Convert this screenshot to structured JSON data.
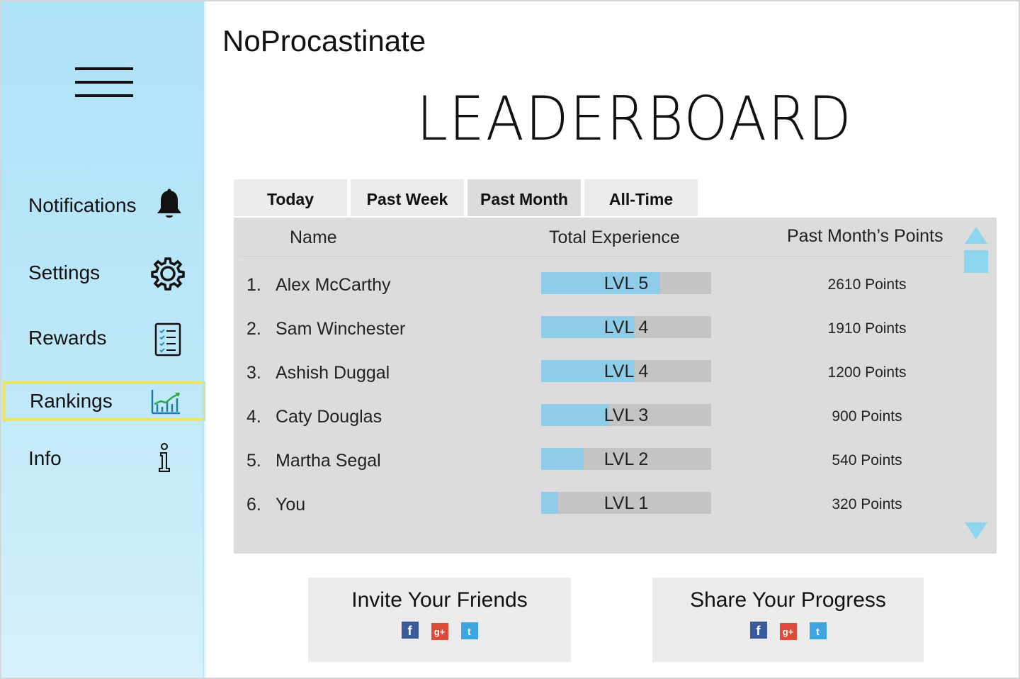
{
  "app": {
    "title": "NoProcastinate"
  },
  "page": {
    "heading": "LEADERBOARD"
  },
  "sidebar": {
    "items": [
      {
        "label": "Notifications",
        "icon": "bell-icon"
      },
      {
        "label": "Settings",
        "icon": "gear-icon"
      },
      {
        "label": "Rewards",
        "icon": "checklist-icon"
      },
      {
        "label": "Rankings",
        "icon": "chart-icon",
        "active": true
      },
      {
        "label": "Info",
        "icon": "info-icon"
      }
    ]
  },
  "tabs": [
    {
      "label": "Today"
    },
    {
      "label": "Past Week"
    },
    {
      "label": "Past Month",
      "active": true
    },
    {
      "label": "All-Time"
    }
  ],
  "table": {
    "headers": {
      "name": "Name",
      "experience": "Total Experience",
      "points": "Past Month’s Points"
    },
    "rows": [
      {
        "rank": "1.",
        "name": "Alex McCarthy",
        "level": "LVL 5",
        "progress": 0.7,
        "points": "2610 Points"
      },
      {
        "rank": "2.",
        "name": "Sam Winchester",
        "level": "LVL 4",
        "progress": 0.55,
        "points": "1910 Points"
      },
      {
        "rank": "3.",
        "name": "Ashish Duggal",
        "level": "LVL 4",
        "progress": 0.55,
        "points": "1200 Points"
      },
      {
        "rank": "4.",
        "name": "Caty Douglas",
        "level": "LVL 3",
        "progress": 0.4,
        "points": "900 Points"
      },
      {
        "rank": "5.",
        "name": "Martha Segal",
        "level": "LVL 2",
        "progress": 0.25,
        "points": "540 Points"
      },
      {
        "rank": "6.",
        "name": "You",
        "level": "LVL 1",
        "progress": 0.1,
        "points": "320 Points"
      }
    ]
  },
  "share": {
    "invite_label": "Invite Your Friends",
    "progress_label": "Share Your Progress",
    "icons": [
      "facebook-icon",
      "google-plus-icon",
      "twitter-icon"
    ]
  },
  "colors": {
    "sidebar": "#aee2f7",
    "progress_fill": "#8ecce8",
    "progress_track": "#c4c4c4",
    "board_bg": "#dcdcdc",
    "highlight": "#efe45a"
  }
}
